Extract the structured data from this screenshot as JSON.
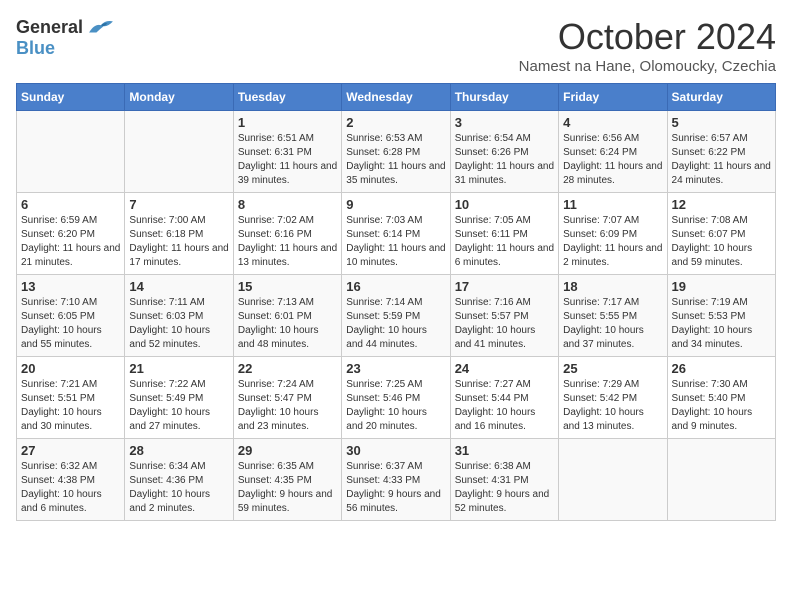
{
  "logo": {
    "general": "General",
    "blue": "Blue"
  },
  "title": "October 2024",
  "subtitle": "Namest na Hane, Olomoucky, Czechia",
  "weekdays": [
    "Sunday",
    "Monday",
    "Tuesday",
    "Wednesday",
    "Thursday",
    "Friday",
    "Saturday"
  ],
  "weeks": [
    [
      {
        "day": "",
        "info": ""
      },
      {
        "day": "",
        "info": ""
      },
      {
        "day": "1",
        "info": "Sunrise: 6:51 AM\nSunset: 6:31 PM\nDaylight: 11 hours and 39 minutes."
      },
      {
        "day": "2",
        "info": "Sunrise: 6:53 AM\nSunset: 6:28 PM\nDaylight: 11 hours and 35 minutes."
      },
      {
        "day": "3",
        "info": "Sunrise: 6:54 AM\nSunset: 6:26 PM\nDaylight: 11 hours and 31 minutes."
      },
      {
        "day": "4",
        "info": "Sunrise: 6:56 AM\nSunset: 6:24 PM\nDaylight: 11 hours and 28 minutes."
      },
      {
        "day": "5",
        "info": "Sunrise: 6:57 AM\nSunset: 6:22 PM\nDaylight: 11 hours and 24 minutes."
      }
    ],
    [
      {
        "day": "6",
        "info": "Sunrise: 6:59 AM\nSunset: 6:20 PM\nDaylight: 11 hours and 21 minutes."
      },
      {
        "day": "7",
        "info": "Sunrise: 7:00 AM\nSunset: 6:18 PM\nDaylight: 11 hours and 17 minutes."
      },
      {
        "day": "8",
        "info": "Sunrise: 7:02 AM\nSunset: 6:16 PM\nDaylight: 11 hours and 13 minutes."
      },
      {
        "day": "9",
        "info": "Sunrise: 7:03 AM\nSunset: 6:14 PM\nDaylight: 11 hours and 10 minutes."
      },
      {
        "day": "10",
        "info": "Sunrise: 7:05 AM\nSunset: 6:11 PM\nDaylight: 11 hours and 6 minutes."
      },
      {
        "day": "11",
        "info": "Sunrise: 7:07 AM\nSunset: 6:09 PM\nDaylight: 11 hours and 2 minutes."
      },
      {
        "day": "12",
        "info": "Sunrise: 7:08 AM\nSunset: 6:07 PM\nDaylight: 10 hours and 59 minutes."
      }
    ],
    [
      {
        "day": "13",
        "info": "Sunrise: 7:10 AM\nSunset: 6:05 PM\nDaylight: 10 hours and 55 minutes."
      },
      {
        "day": "14",
        "info": "Sunrise: 7:11 AM\nSunset: 6:03 PM\nDaylight: 10 hours and 52 minutes."
      },
      {
        "day": "15",
        "info": "Sunrise: 7:13 AM\nSunset: 6:01 PM\nDaylight: 10 hours and 48 minutes."
      },
      {
        "day": "16",
        "info": "Sunrise: 7:14 AM\nSunset: 5:59 PM\nDaylight: 10 hours and 44 minutes."
      },
      {
        "day": "17",
        "info": "Sunrise: 7:16 AM\nSunset: 5:57 PM\nDaylight: 10 hours and 41 minutes."
      },
      {
        "day": "18",
        "info": "Sunrise: 7:17 AM\nSunset: 5:55 PM\nDaylight: 10 hours and 37 minutes."
      },
      {
        "day": "19",
        "info": "Sunrise: 7:19 AM\nSunset: 5:53 PM\nDaylight: 10 hours and 34 minutes."
      }
    ],
    [
      {
        "day": "20",
        "info": "Sunrise: 7:21 AM\nSunset: 5:51 PM\nDaylight: 10 hours and 30 minutes."
      },
      {
        "day": "21",
        "info": "Sunrise: 7:22 AM\nSunset: 5:49 PM\nDaylight: 10 hours and 27 minutes."
      },
      {
        "day": "22",
        "info": "Sunrise: 7:24 AM\nSunset: 5:47 PM\nDaylight: 10 hours and 23 minutes."
      },
      {
        "day": "23",
        "info": "Sunrise: 7:25 AM\nSunset: 5:46 PM\nDaylight: 10 hours and 20 minutes."
      },
      {
        "day": "24",
        "info": "Sunrise: 7:27 AM\nSunset: 5:44 PM\nDaylight: 10 hours and 16 minutes."
      },
      {
        "day": "25",
        "info": "Sunrise: 7:29 AM\nSunset: 5:42 PM\nDaylight: 10 hours and 13 minutes."
      },
      {
        "day": "26",
        "info": "Sunrise: 7:30 AM\nSunset: 5:40 PM\nDaylight: 10 hours and 9 minutes."
      }
    ],
    [
      {
        "day": "27",
        "info": "Sunrise: 6:32 AM\nSunset: 4:38 PM\nDaylight: 10 hours and 6 minutes."
      },
      {
        "day": "28",
        "info": "Sunrise: 6:34 AM\nSunset: 4:36 PM\nDaylight: 10 hours and 2 minutes."
      },
      {
        "day": "29",
        "info": "Sunrise: 6:35 AM\nSunset: 4:35 PM\nDaylight: 9 hours and 59 minutes."
      },
      {
        "day": "30",
        "info": "Sunrise: 6:37 AM\nSunset: 4:33 PM\nDaylight: 9 hours and 56 minutes."
      },
      {
        "day": "31",
        "info": "Sunrise: 6:38 AM\nSunset: 4:31 PM\nDaylight: 9 hours and 52 minutes."
      },
      {
        "day": "",
        "info": ""
      },
      {
        "day": "",
        "info": ""
      }
    ]
  ]
}
